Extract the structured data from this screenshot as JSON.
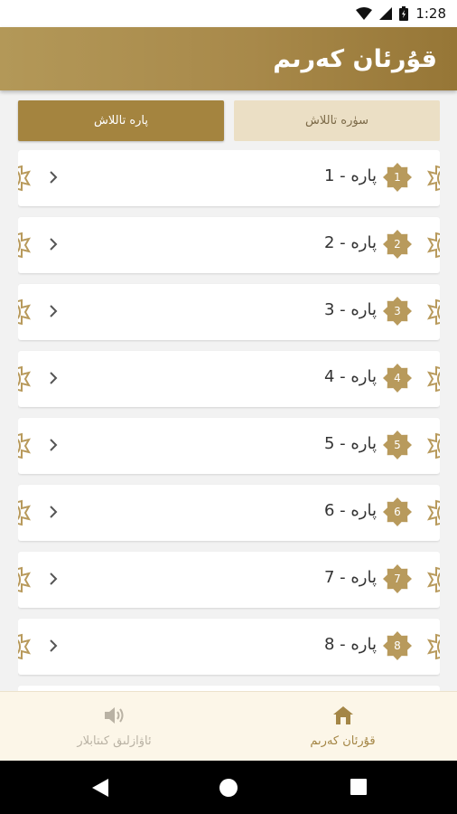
{
  "status_bar": {
    "time": "1:28",
    "icons": [
      "wifi-icon",
      "signal-icon",
      "battery-charging-icon"
    ]
  },
  "app_bar": {
    "title": "قۇرئان كەرىم"
  },
  "tabs": [
    {
      "label": "پارە تاللاش",
      "active": true
    },
    {
      "label": "سۈرە تاللاش",
      "active": false
    }
  ],
  "juz_list": [
    {
      "number": "1",
      "label": "1 - پارە"
    },
    {
      "number": "2",
      "label": "2 - پارە"
    },
    {
      "number": "3",
      "label": "3 - پارە"
    },
    {
      "number": "4",
      "label": "4 - پارە"
    },
    {
      "number": "5",
      "label": "5 - پارە"
    },
    {
      "number": "6",
      "label": "6 - پارە"
    },
    {
      "number": "7",
      "label": "7 - پارە"
    },
    {
      "number": "8",
      "label": "8 - پارە"
    }
  ],
  "bottom_nav": {
    "items": [
      {
        "label": "ئاۋازلىق كىتابلار",
        "icon": "speaker-icon",
        "active": false
      },
      {
        "label": "قۇرئان كەرىم",
        "icon": "home-icon",
        "active": true
      }
    ]
  },
  "system_nav": {
    "icons": [
      "back-icon",
      "home-circle-icon",
      "recents-icon"
    ]
  },
  "colors": {
    "accent": "#a4843f",
    "tab_inactive_bg": "#ebdfc5",
    "ornament": "#b89a5c",
    "nav_active": "#a48646",
    "nav_inactive": "#b9b2a4"
  }
}
